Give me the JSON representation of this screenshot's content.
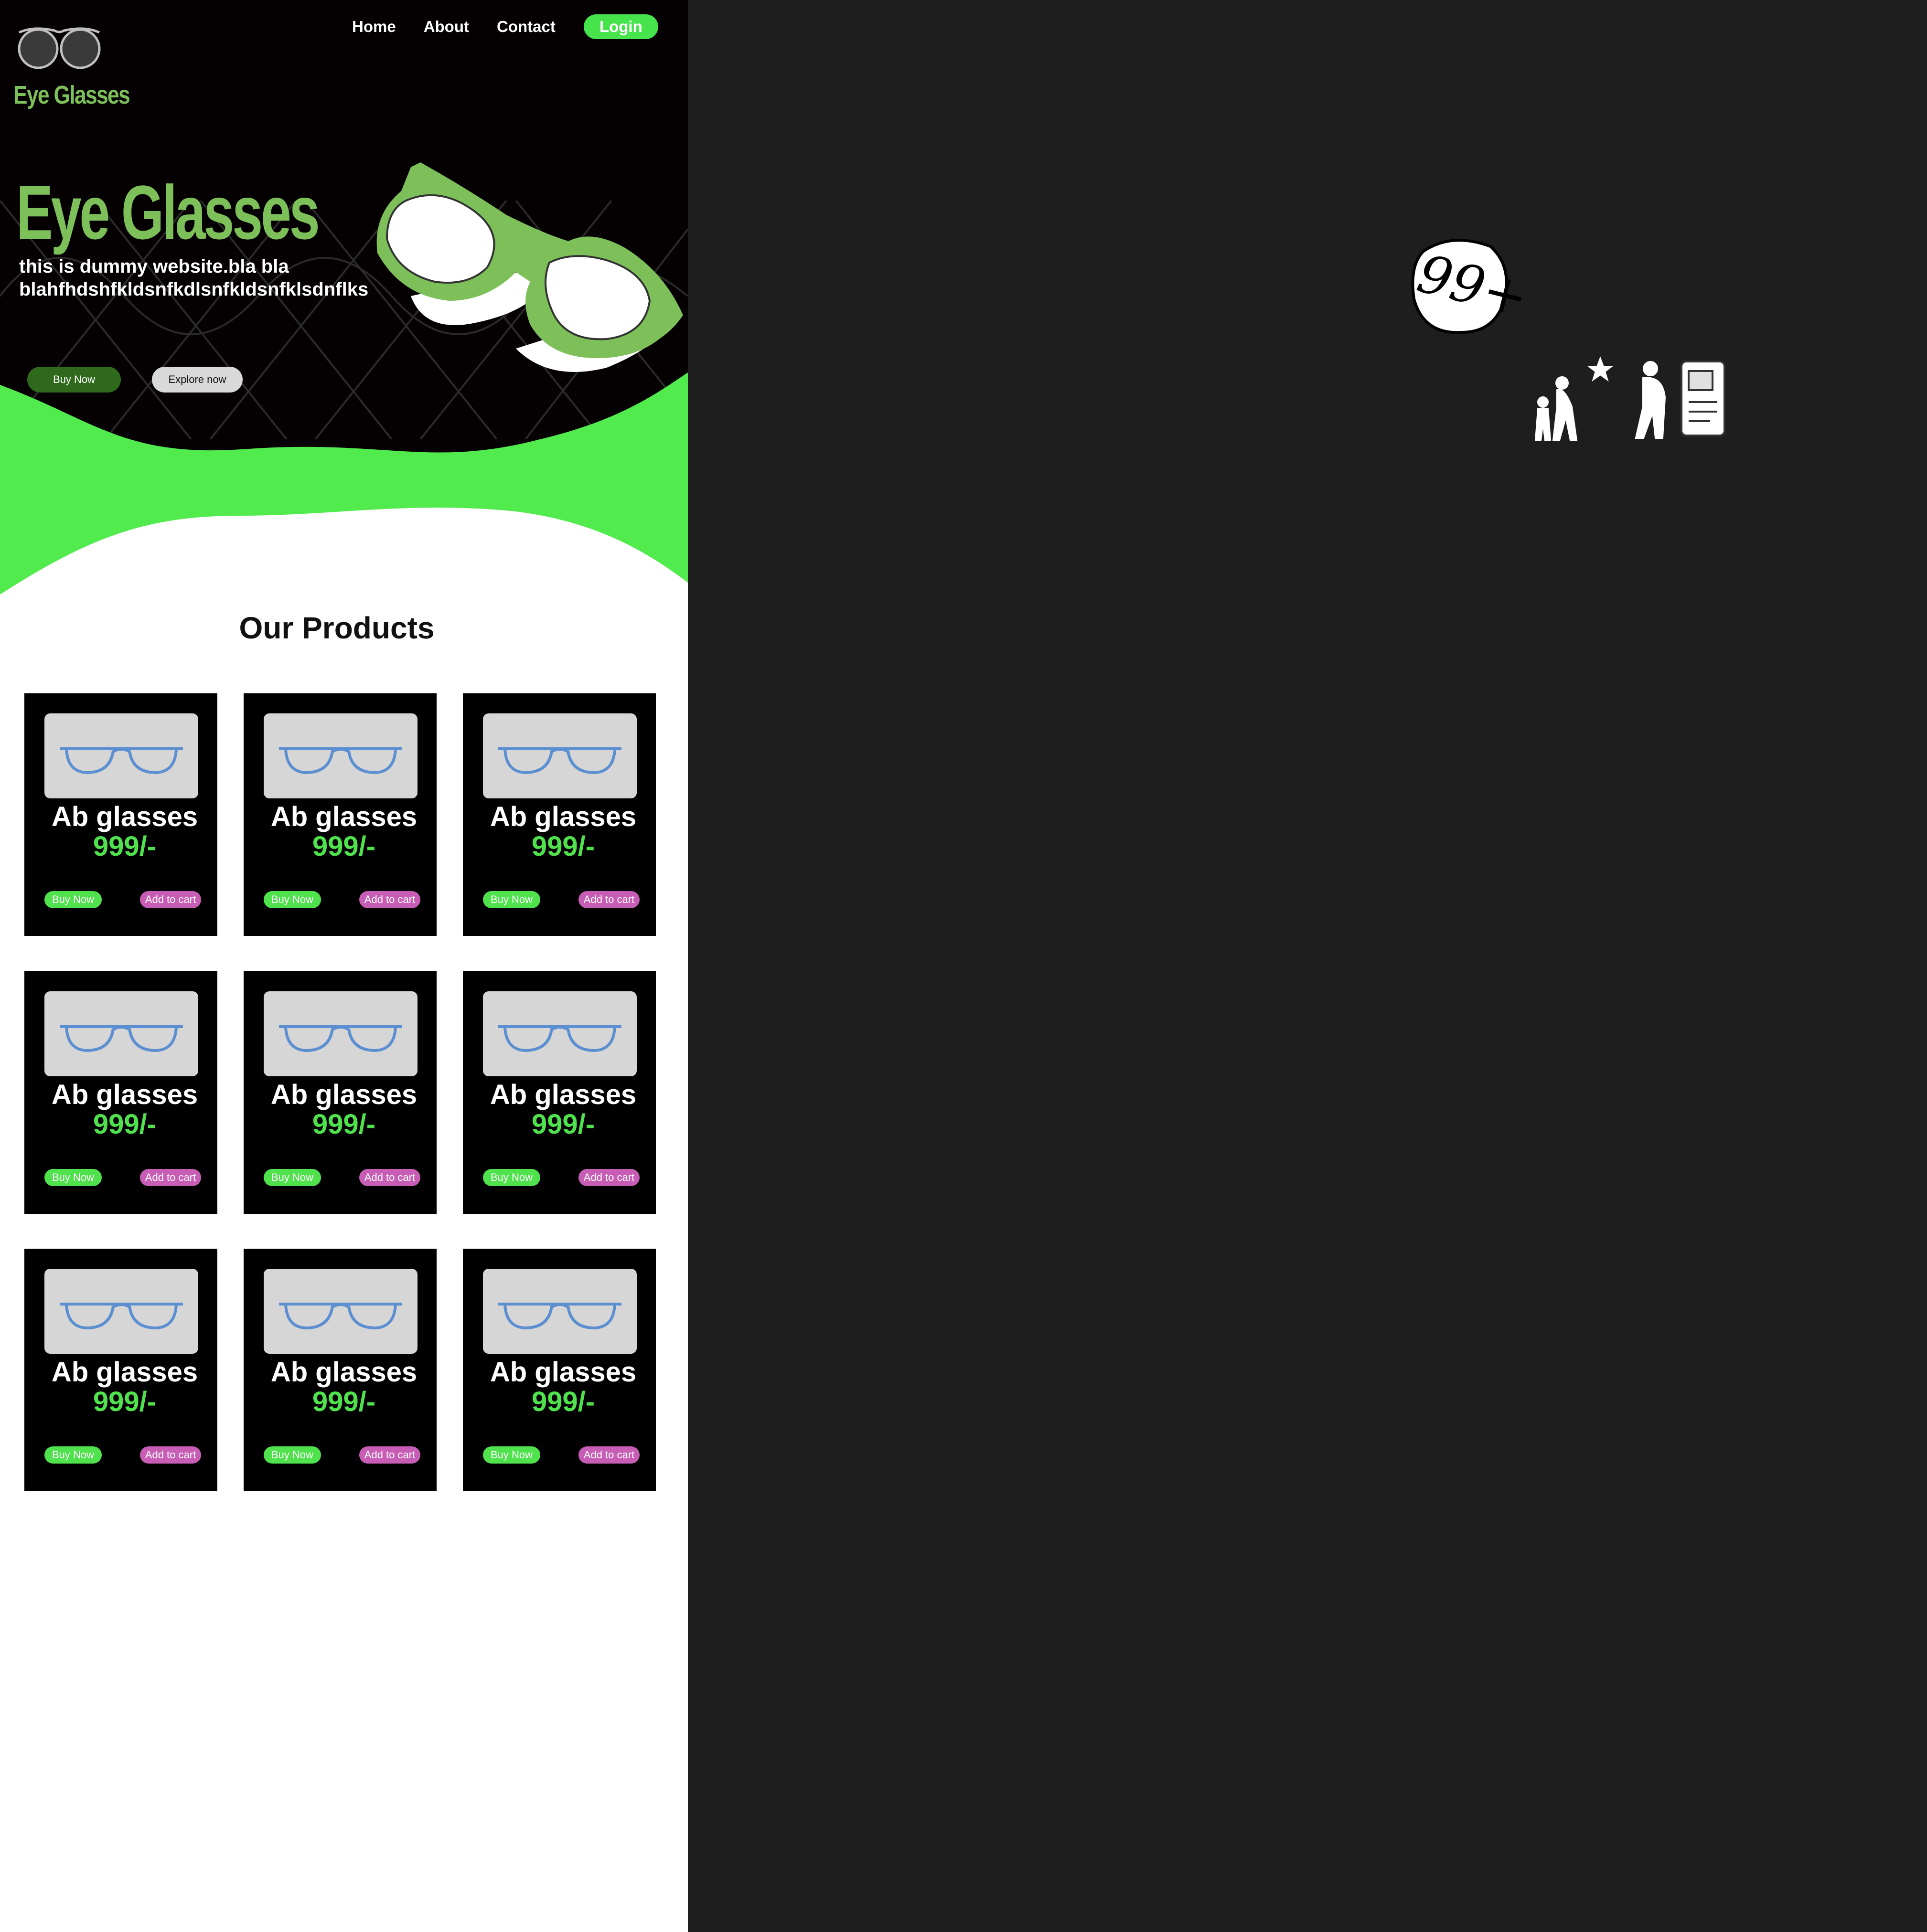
{
  "nav": {
    "items": [
      "Home",
      "About",
      "Contact"
    ],
    "login_label": "Login"
  },
  "brand": {
    "logo_text": "Eye Glasses"
  },
  "hero": {
    "title": "Eye Glasses",
    "description": "this is dummy website.bla bla blahfhdshfkldsnfkdlsnfkldsnfklsdnflks",
    "buy_label": "Buy Now",
    "explore_label": "Explore now"
  },
  "products": {
    "title": "Our Products",
    "items": [
      {
        "name": "Ab glasses",
        "price": "999/-",
        "buy_label": "Buy Now",
        "cart_label": "Add to cart"
      },
      {
        "name": "Ab glasses",
        "price": "999/-",
        "buy_label": "Buy Now",
        "cart_label": "Add to cart"
      },
      {
        "name": "Ab glasses",
        "price": "999/-",
        "buy_label": "Buy Now",
        "cart_label": "Add to cart"
      },
      {
        "name": "Ab glasses",
        "price": "999/-",
        "buy_label": "Buy Now",
        "cart_label": "Add to cart"
      },
      {
        "name": "Ab glasses",
        "price": "999/-",
        "buy_label": "Buy Now",
        "cart_label": "Add to cart"
      },
      {
        "name": "Ab glasses",
        "price": "999/-",
        "buy_label": "Buy Now",
        "cart_label": "Add to cart"
      },
      {
        "name": "Ab glasses",
        "price": "999/-",
        "buy_label": "Buy Now",
        "cart_label": "Add to cart"
      },
      {
        "name": "Ab glasses",
        "price": "999/-",
        "buy_label": "Buy Now",
        "cart_label": "Add to cart"
      },
      {
        "name": "Ab glasses",
        "price": "999/-",
        "buy_label": "Buy Now",
        "cart_label": "Add to cart"
      }
    ]
  },
  "badge": {
    "text": "99+"
  },
  "icons": {
    "logo": "eyeglasses-icon",
    "hero_art": "green-glasses-icon",
    "product": "blue-glasses-icon",
    "illustration": "people-illustration-icon"
  },
  "colors": {
    "accent_green": "#47e34c",
    "brand_green": "#7dbf58",
    "dark_green": "#2f6a1c",
    "cart_pink": "#c75db4",
    "hero_bg": "#050102",
    "canvas_bg": "#1e1e1e"
  }
}
